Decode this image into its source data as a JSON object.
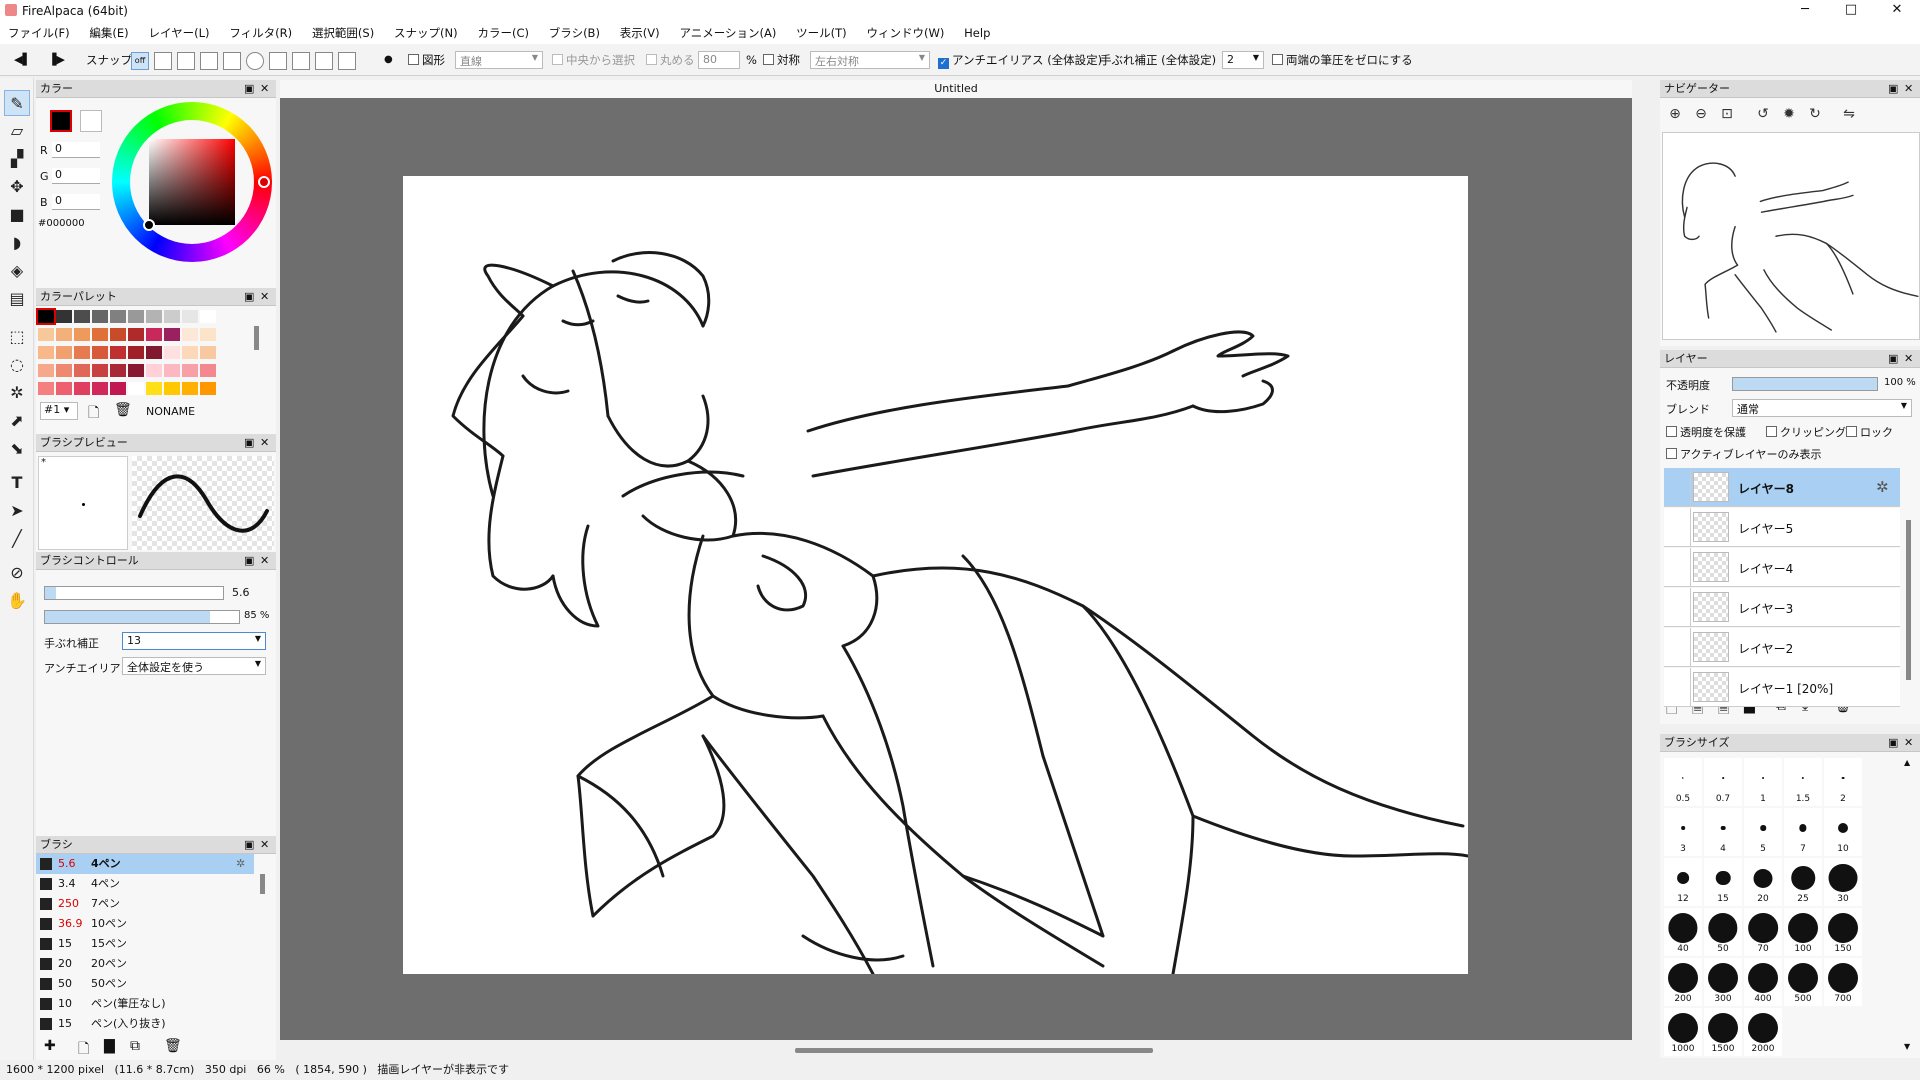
{
  "window": {
    "title": "FireAlpaca (64bit)",
    "minimize": "─",
    "maximize": "□",
    "close": "✕"
  },
  "menu": [
    "ファイル(F)",
    "編集(E)",
    "レイヤー(L)",
    "フィルタ(R)",
    "選択範囲(S)",
    "スナップ(N)",
    "カラー(C)",
    "ブラシ(B)",
    "表示(V)",
    "アニメーション(A)",
    "ツール(T)",
    "ウィンドウ(W)",
    "Help"
  ],
  "toolbar": {
    "snap_label": "スナップ",
    "snap_off": "off",
    "shape_label": "図形",
    "shape_value": "直線",
    "center_label": "中央から選択",
    "round_label": "丸める",
    "round_value": "80",
    "round_unit": "%",
    "sym_label": "対称",
    "sym_value": "左右対称",
    "aa_label": "アンチエイリアス (全体設定)",
    "stab_label": "手ぶれ補正 (全体設定)",
    "stab_value": "2",
    "ends_label": "両端の筆圧をゼロにする"
  },
  "color_panel": {
    "title": "カラー",
    "r_label": "R",
    "r_value": "0",
    "g_label": "G",
    "g_value": "0",
    "b_label": "B",
    "b_value": "0",
    "hex": "#000000",
    "foreground": "#000000"
  },
  "palette_panel": {
    "title": "カラーパレット",
    "index": "#1",
    "name": "NONAME",
    "rows": [
      [
        "#000000",
        "#333333",
        "#4d4d4d",
        "#666666",
        "#808080",
        "#999999",
        "#b3b3b3",
        "#cccccc",
        "#e6e6e6",
        "#ffffff"
      ],
      [
        "#f7c89a",
        "#f4b07a",
        "#ee9a5a",
        "#e0703a",
        "#c84c2a",
        "#b02a2a",
        "#c8285a",
        "#9a2060",
        "#fde8d8",
        "#fbe4c8"
      ],
      [
        "#f8b88a",
        "#f2a070",
        "#e67a50",
        "#d8583a",
        "#c03030",
        "#a02028",
        "#801830",
        "#ffe0e0",
        "#fcd8b8",
        "#f8c8a0"
      ],
      [
        "#f7a88a",
        "#ee8870",
        "#e06858",
        "#c84040",
        "#a82838",
        "#881830",
        "#ffd0d8",
        "#fbb8c0",
        "#f8a0a8",
        "#f48890"
      ],
      [
        "#f48080",
        "#ee6070",
        "#e04060",
        "#d02858",
        "#c01850",
        "#ffffff",
        "#ffe018",
        "#ffc800",
        "#ffb000",
        "#ff9800"
      ]
    ]
  },
  "brush_preview": {
    "title": "ブラシプレビュー",
    "marker": "*"
  },
  "brush_control": {
    "title": "ブラシコントロール",
    "size_value": "5.6",
    "size_fraction": 0.06,
    "opacity_value": "85",
    "opacity_unit": "%",
    "opacity_fraction": 0.85,
    "stab_label": "手ぶれ補正",
    "stab_value": "13",
    "aa_label": "アンチエイリアス",
    "aa_value": "全体設定を使う"
  },
  "brush_panel": {
    "title": "ブラシ",
    "items": [
      {
        "size": "5.6",
        "name": "4ペン",
        "red": true,
        "selected": true
      },
      {
        "size": "3.4",
        "name": "4ペン",
        "red": false
      },
      {
        "size": "250",
        "name": "7ペン",
        "red": true
      },
      {
        "size": "36.9",
        "name": "10ペン",
        "red": true
      },
      {
        "size": "15",
        "name": "15ペン",
        "red": false
      },
      {
        "size": "20",
        "name": "20ペン",
        "red": false
      },
      {
        "size": "50",
        "name": "50ペン",
        "red": false
      },
      {
        "size": "10",
        "name": "ペン(筆圧なし)",
        "red": false
      },
      {
        "size": "15",
        "name": "ペン(入り抜き)",
        "red": false
      }
    ]
  },
  "document": {
    "tab": "Untitled"
  },
  "navigator": {
    "title": "ナビゲーター"
  },
  "layer_panel": {
    "title": "レイヤー",
    "opacity_label": "不透明度",
    "opacity_value": "100",
    "opacity_unit": "%",
    "opacity_fraction": 1.0,
    "blend_label": "ブレンド",
    "blend_value": "通常",
    "protect_label": "透明度を保護",
    "clip_label": "クリッピング",
    "lock_label": "ロック",
    "active_only_label": "アクティブレイヤーのみ表示",
    "layers": [
      {
        "name": "レイヤー8",
        "selected": true
      },
      {
        "name": "レイヤー5",
        "selected": false
      },
      {
        "name": "レイヤー4",
        "selected": false
      },
      {
        "name": "レイヤー3",
        "selected": false
      },
      {
        "name": "レイヤー2",
        "selected": false
      },
      {
        "name": "レイヤー1 [20%]",
        "selected": false
      }
    ]
  },
  "brush_size_panel": {
    "title": "ブラシサイズ",
    "sizes": [
      "0.5",
      "0.7",
      "1",
      "1.5",
      "2",
      "3",
      "4",
      "5",
      "7",
      "10",
      "12",
      "15",
      "20",
      "25",
      "30",
      "40",
      "50",
      "70",
      "100",
      "150",
      "200",
      "300",
      "400",
      "500",
      "700",
      "1000",
      "1500",
      "2000"
    ]
  },
  "status": {
    "size": "1600 * 1200 pixel",
    "physical": "(11.6 * 8.7cm)",
    "dpi": "350 dpi",
    "zoom": "66 %",
    "cursor": "( 1854, 590 )",
    "message": "描画レイヤーが非表示です"
  }
}
